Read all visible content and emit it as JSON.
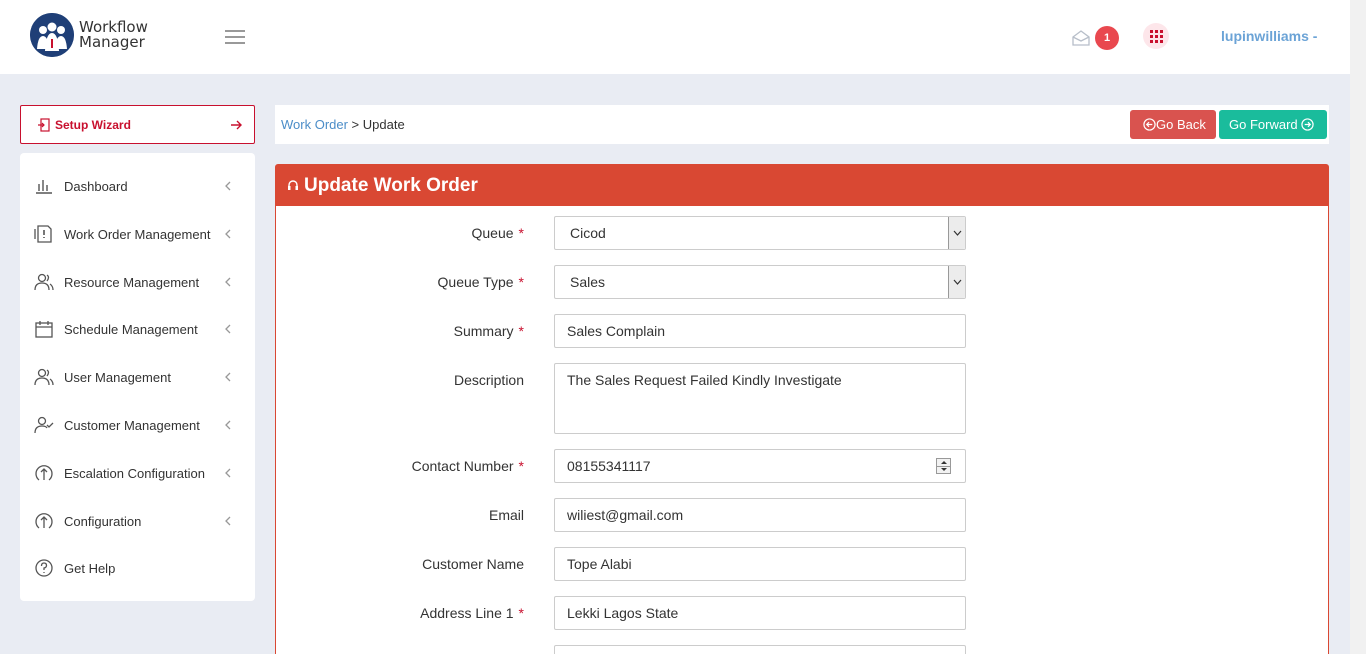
{
  "header": {
    "logo_line1": "Workflow",
    "logo_line2": "Manager",
    "notification_count": "1",
    "username": "lupinwilliams -"
  },
  "wizard": {
    "label": "Setup Wizard"
  },
  "sidebar": {
    "items": [
      {
        "label": "Dashboard",
        "icon": "bar-chart-icon"
      },
      {
        "label": "Work Order Management",
        "icon": "document-alert-icon"
      },
      {
        "label": "Resource Management",
        "icon": "users-icon"
      },
      {
        "label": "Schedule Management",
        "icon": "calendar-icon"
      },
      {
        "label": "User Management",
        "icon": "users-icon"
      },
      {
        "label": "Customer Management",
        "icon": "user-check-icon"
      },
      {
        "label": "Escalation Configuration",
        "icon": "arrow-up-circle-icon"
      },
      {
        "label": "Configuration",
        "icon": "arrow-up-circle-icon"
      },
      {
        "label": "Get Help",
        "icon": "help-circle-icon"
      }
    ]
  },
  "breadcrumb": {
    "link": "Work Order",
    "separator": " > ",
    "current": "Update"
  },
  "buttons": {
    "back": "Go Back",
    "forward": "Go Forward"
  },
  "form": {
    "title": "Update Work Order",
    "queue": {
      "label": "Queue",
      "value": "Cicod"
    },
    "queue_type": {
      "label": "Queue Type",
      "value": "Sales"
    },
    "summary": {
      "label": "Summary",
      "value": "Sales Complain"
    },
    "description": {
      "label": "Description",
      "value": "The Sales Request Failed Kindly Investigate"
    },
    "contact_number": {
      "label": "Contact Number",
      "value": "08155341117"
    },
    "email": {
      "label": "Email",
      "value": "wiliest@gmail.com"
    },
    "customer_name": {
      "label": "Customer Name",
      "value": "Tope Alabi"
    },
    "address_line1": {
      "label": "Address Line 1",
      "value": "Lekki Lagos State"
    },
    "required_mark": "*"
  },
  "colors": {
    "brand_red": "#c8102e",
    "header_red": "#d94833",
    "link_blue": "#4b8dc8",
    "forward_green": "#1abc9c",
    "back_red": "#d9534f"
  }
}
